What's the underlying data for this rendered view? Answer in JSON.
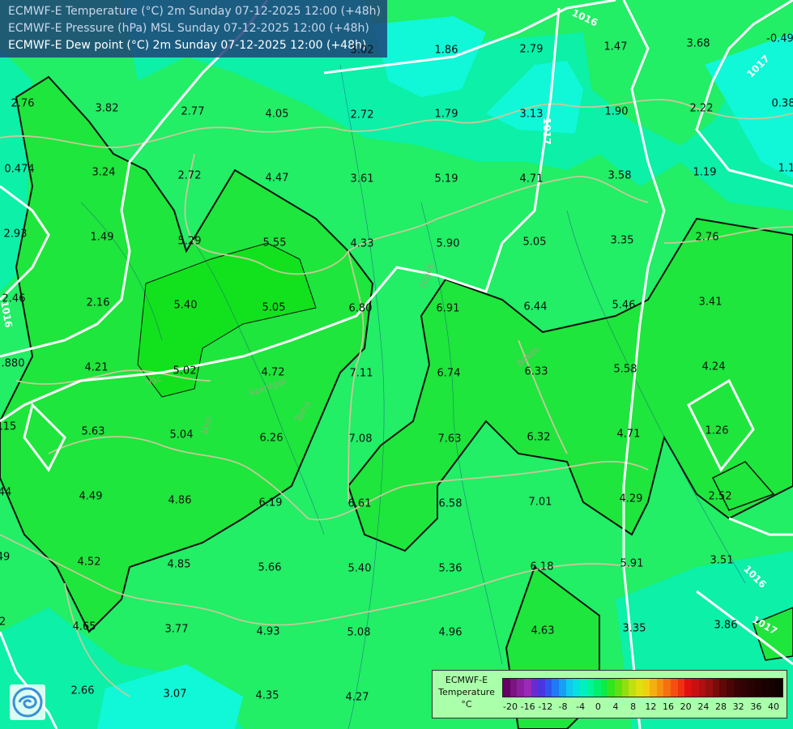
{
  "header": {
    "lines": [
      "ECMWF-E Temperature (°C) 2m Sunday 07-12-2025 12:00 (+48h)",
      "ECMWF-E Pressure (hPa) MSL Sunday 07-12-2025 12:00 (+48h)",
      "ECMWF-E Dew point (°C) 2m Sunday 07-12-2025 12:00 (+48h)"
    ]
  },
  "values": [
    "2.76",
    "3.82",
    "2.77",
    "4.05",
    "2.72",
    "1.79",
    "3.13",
    "1.90",
    "2.22",
    "0.474",
    "3.24",
    "2.72",
    "4.47",
    "3.61",
    "5.19",
    "4.71",
    "3.58",
    "1.19",
    "2.93",
    "1.49",
    "5.29",
    "5.55",
    "4.33",
    "5.90",
    "5.05",
    "3.35",
    "2.76",
    "2.46",
    "2.16",
    "5.40",
    "5.05",
    "6.80",
    "6.91",
    "6.44",
    "5.46",
    "3.41",
    ".880",
    "4.21",
    "5.02",
    "4.72",
    "7.11",
    "6.74",
    "6.33",
    "5.58",
    "4.24",
    ".15",
    "5.63",
    "5.04",
    "6.26",
    "7.08",
    "7.63",
    "6.32",
    "4.71",
    "1.26",
    "4.49",
    "4.86",
    "6.19",
    "6.61",
    "6.58",
    "7.01",
    "4.29",
    "2.52",
    "4.52",
    "4.85",
    "5.66",
    "5.40",
    "5.36",
    "6.18",
    "5.91",
    "3.51",
    "4.65",
    "3.77",
    "4.93",
    "5.08",
    "4.96",
    "4.63",
    "3.35",
    "3.86",
    "2.66",
    "3.07",
    "4.35",
    "4.27",
    "3.02",
    "1.86",
    "2.79",
    "1.47",
    "3.68",
    "-0.49",
    "0.38",
    "1.1",
    "44",
    "49",
    "2"
  ],
  "isobars": [
    "1016",
    "1017",
    "1017",
    "1016",
    "1016",
    "1017"
  ],
  "place_names": [
    "Hajós",
    "Békés",
    "Szentgál",
    "Tolna",
    "Jász",
    "Vác"
  ],
  "legend": {
    "title": [
      "ECMWF-E",
      "Temperature",
      "°C"
    ],
    "ticks": [
      "-20",
      "-16",
      "-12",
      "-8",
      "-4",
      "0",
      "4",
      "8",
      "12",
      "16",
      "20",
      "24",
      "28",
      "32",
      "36",
      "40"
    ],
    "colors": [
      "#660066",
      "#7a1480",
      "#8c1fa0",
      "#9a2ab8",
      "#6a2ad0",
      "#4a35e0",
      "#2f55f0",
      "#1f7af5",
      "#15a0f5",
      "#10c8f0",
      "#05e0e0",
      "#00f0c0",
      "#00f59a",
      "#00f070",
      "#10ea45",
      "#30e620",
      "#60e010",
      "#90e010",
      "#c0e010",
      "#e0e010",
      "#f0d010",
      "#f5b010",
      "#f59010",
      "#f57010",
      "#f55010",
      "#f03010",
      "#e01010",
      "#c81010",
      "#b01010",
      "#961010",
      "#7a0c0c",
      "#600808",
      "#4a0606",
      "#3a0404",
      "#300404",
      "#280303",
      "#200202",
      "#1a0202",
      "#150101",
      "#100101"
    ],
    "tick_color": "#111111"
  },
  "colors": {
    "field_warm": "#1ee63c",
    "field_mid": "#22ee66",
    "field_cool": "#0af5a0",
    "field_cold": "#0cf8d8",
    "isobar": "#ffffff",
    "contour": "#111111",
    "border": "#c8c89a"
  },
  "logo_icon": "ecmwf-logo-icon"
}
